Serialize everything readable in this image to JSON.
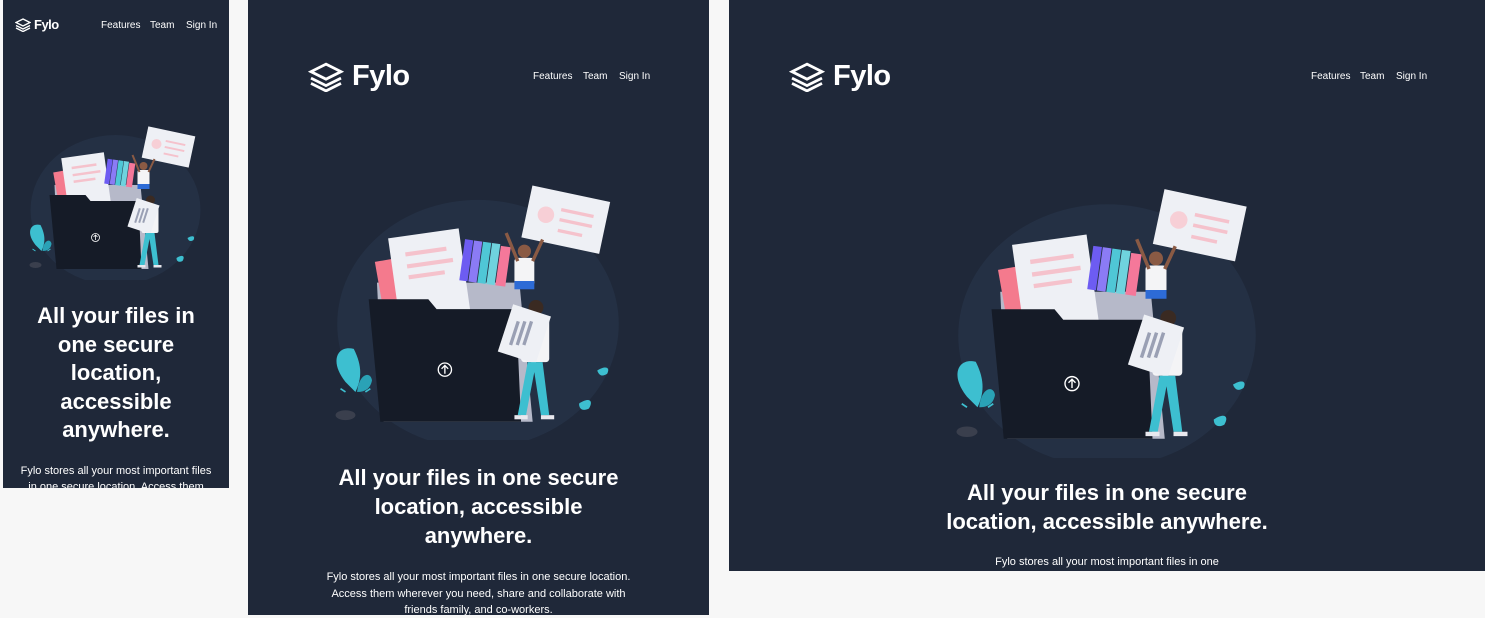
{
  "brand": {
    "name": "Fylo"
  },
  "nav": [
    {
      "label": "Features"
    },
    {
      "label": "Team"
    },
    {
      "label": "Sign In"
    }
  ],
  "hero": {
    "headline": "All your files in one secure location, accessible anywhere.",
    "mobile_headline_lines": [
      "All your files in",
      "one secure",
      "location,",
      "accessible",
      "anywhere."
    ],
    "tablet_headline_lines": [
      "All your files in one secure",
      "location, accessible",
      "anywhere."
    ],
    "desktop_headline_lines": [
      "All your files in one secure",
      "location, accessible anywhere."
    ],
    "mobile_sub_lines": [
      "Fylo stores all your most important files",
      "in one secure location. Access them"
    ],
    "tablet_sub_lines": [
      "Fylo stores all your most important files in one secure location.",
      "Access them wherever you need, share and collaborate with",
      "friends family, and co-workers."
    ],
    "desktop_sub_lines": [
      "Fylo stores all your most important files in one"
    ]
  },
  "colors": {
    "background": "#1f2839",
    "page": "#f7f7f7",
    "accent_teal": "#3dbfd0",
    "accent_pink": "#f9a8b5"
  },
  "icons": {
    "logo": "stacked-layers-icon",
    "upload": "upload-arrow-icon"
  }
}
